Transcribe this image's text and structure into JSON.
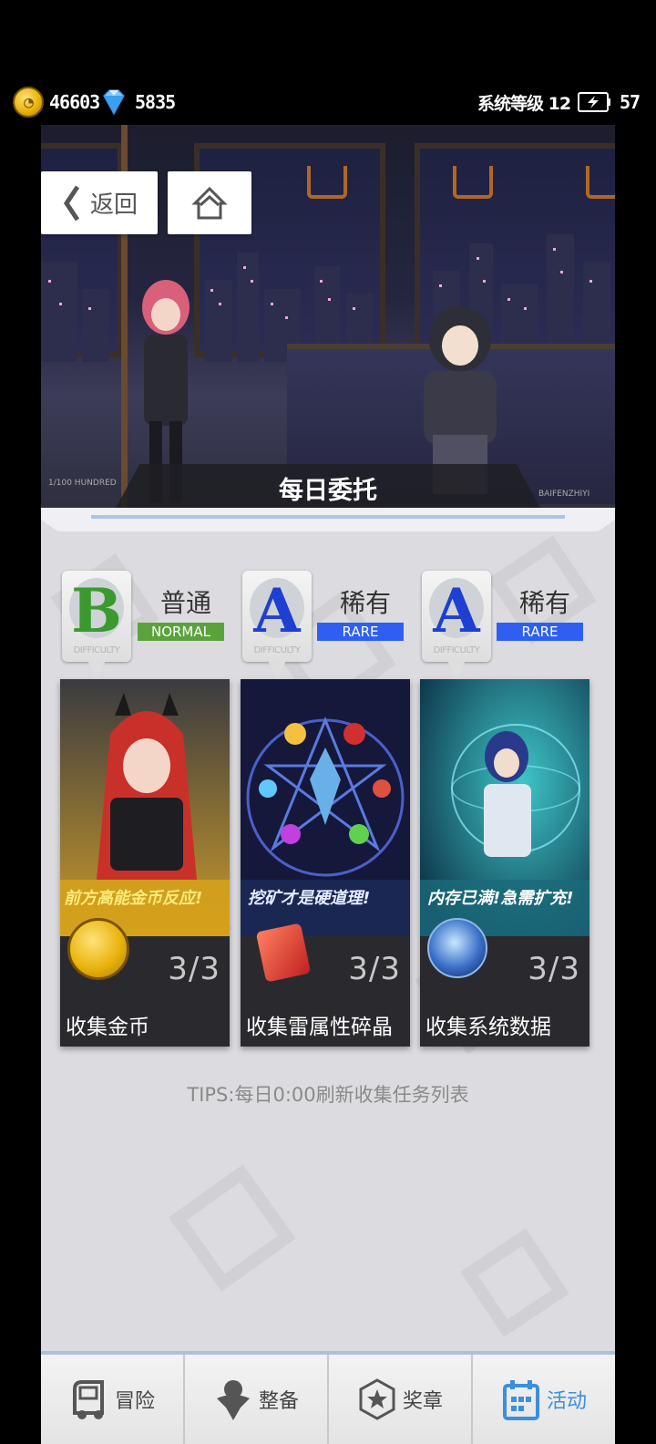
{
  "status": {
    "coins": "46603",
    "gems": "5835",
    "system_level_label": "系统等级 12",
    "energy": "57"
  },
  "nav_buttons": {
    "back_label": "返回"
  },
  "hero": {
    "title": "每日委托",
    "tag_left": "1/100 HUNDRED",
    "tag_right": "BAIFENZHIYI"
  },
  "cards": [
    {
      "grade": "B",
      "grade_color": "#3a9a2e",
      "rarity_cn": "普通",
      "rarity_en": "NORMAL",
      "rarity_color": "#5aa33c",
      "difficulty": "DIFFICULTY",
      "banner": "前方高能金币反应!",
      "count": "3/3",
      "name": "收集金币"
    },
    {
      "grade": "A",
      "grade_color": "#1f3fd0",
      "rarity_cn": "稀有",
      "rarity_en": "RARE",
      "rarity_color": "#2f5ff2",
      "difficulty": "DIFFICULTY",
      "banner": "挖矿才是硬道理!",
      "count": "3/3",
      "name": "收集雷属性碎晶"
    },
    {
      "grade": "A",
      "grade_color": "#1f3fd0",
      "rarity_cn": "稀有",
      "rarity_en": "RARE",
      "rarity_color": "#2f5ff2",
      "difficulty": "DIFFICULTY",
      "banner": "内存已满!急需扩充!",
      "count": "3/3",
      "name": "收集系统数据"
    }
  ],
  "tips": "TIPS:每日0:00刷新收集任务列表",
  "bottom_nav": [
    {
      "label": "冒险",
      "icon": "vehicle-icon"
    },
    {
      "label": "整备",
      "icon": "gear-figure-icon"
    },
    {
      "label": "奖章",
      "icon": "medal-icon"
    },
    {
      "label": "活动",
      "icon": "calendar-icon"
    }
  ],
  "colors": {
    "accent": "#3a8fdf",
    "panel": "#dcdce0"
  }
}
